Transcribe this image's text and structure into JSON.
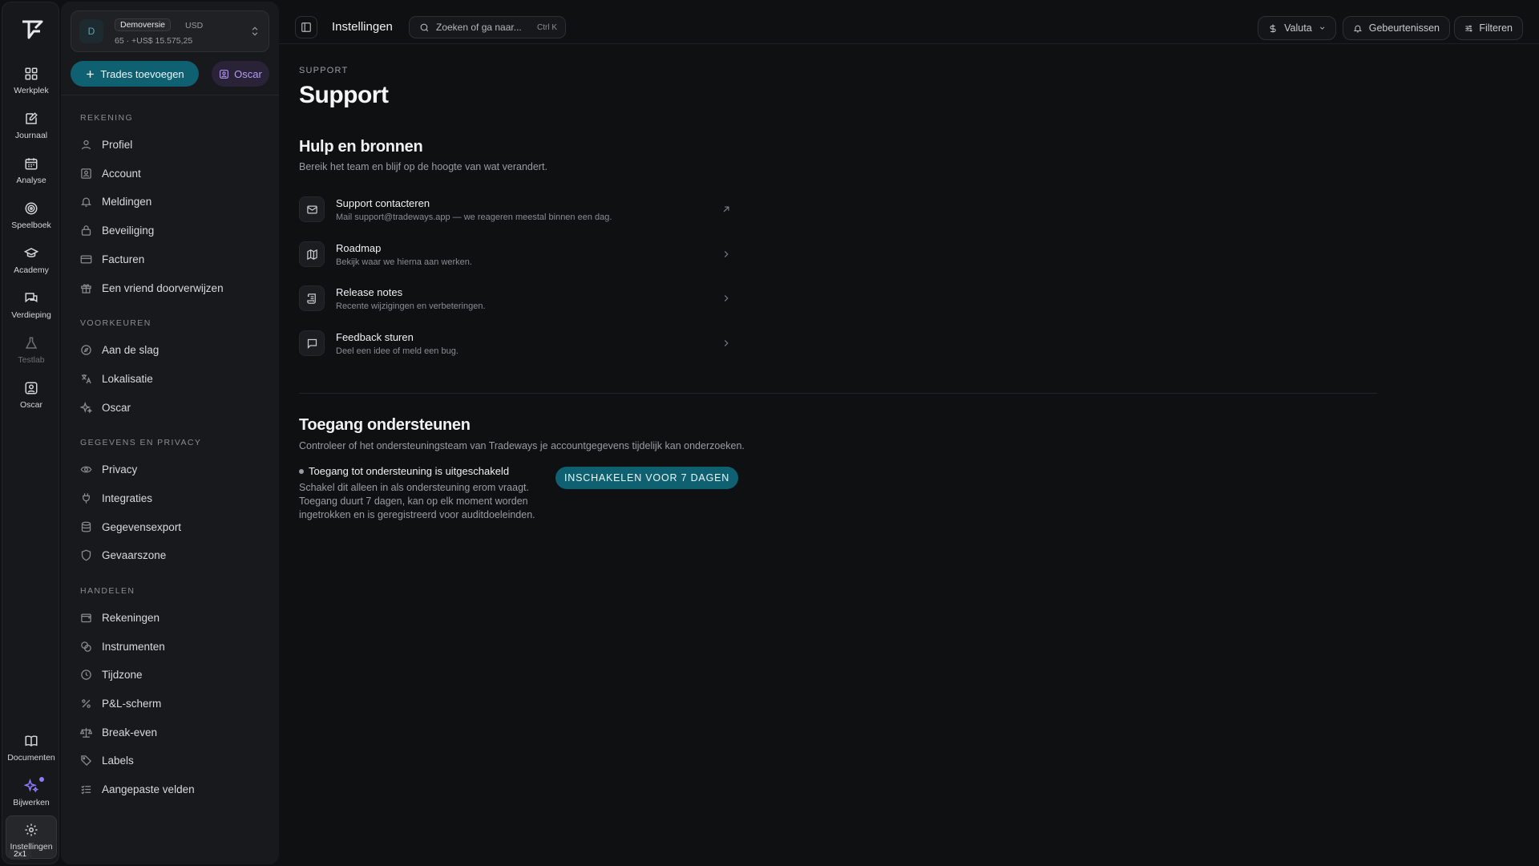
{
  "rail": {
    "items": [
      {
        "label": "Werkplek",
        "icon": "grid-icon"
      },
      {
        "label": "Journaal",
        "icon": "edit-note-icon"
      },
      {
        "label": "Analyse",
        "icon": "calendar-icon"
      },
      {
        "label": "Speelboek",
        "icon": "target-icon"
      },
      {
        "label": "Academy",
        "icon": "graduation-cap-icon"
      },
      {
        "label": "Verdieping",
        "icon": "chat-icon"
      },
      {
        "label": "Testlab",
        "icon": "flask-icon"
      },
      {
        "label": "Oscar",
        "icon": "user-square-icon"
      }
    ],
    "bottom": [
      {
        "label": "Documenten",
        "icon": "book-icon"
      },
      {
        "label": "Bijwerken",
        "icon": "sparkles-icon"
      },
      {
        "label": "Instellingen",
        "icon": "gear-icon"
      }
    ],
    "badge": "2x1"
  },
  "account": {
    "avatar_letter": "D",
    "name": "Demoversie",
    "currency": "USD",
    "balance": "65 · +US$ 15.575,25"
  },
  "actions": {
    "add_trades": "Trades toevoegen",
    "oscar": "Oscar"
  },
  "sidebar": {
    "sections": [
      {
        "title": "REKENING",
        "items": [
          "Profiel",
          "Account",
          "Meldingen",
          "Beveiliging",
          "Facturen",
          "Een vriend doorverwijzen"
        ]
      },
      {
        "title": "VOORKEUREN",
        "items": [
          "Aan de slag",
          "Lokalisatie",
          "Oscar"
        ]
      },
      {
        "title": "GEGEVENS EN PRIVACY",
        "items": [
          "Privacy",
          "Integraties",
          "Gegevensexport",
          "Gevaarszone"
        ]
      },
      {
        "title": "HANDELEN",
        "items": [
          "Rekeningen",
          "Instrumenten",
          "Tijdzone",
          "P&L-scherm",
          "Break-even",
          "Labels",
          "Aangepaste velden"
        ]
      }
    ]
  },
  "topbar": {
    "title": "Instellingen",
    "search_placeholder": "Zoeken of ga naar...",
    "search_shortcut": "Ctrl K",
    "currency": "Valuta",
    "events": "Gebeurtenissen",
    "filters": "Filteren"
  },
  "page": {
    "breadcrumb": "SUPPORT",
    "title": "Support",
    "help": {
      "title": "Hulp en bronnen",
      "subtitle": "Bereik het team en blijf op de hoogte van wat verandert.",
      "rows": [
        {
          "title": "Support contacteren",
          "desc": "Mail support@tradeways.app — we reageren meestal binnen een dag.",
          "icon": "mail-icon"
        },
        {
          "title": "Roadmap",
          "desc": "Bekijk waar we hierna aan werken.",
          "icon": "map-icon"
        },
        {
          "title": "Release notes",
          "desc": "Recente wijzigingen en verbeteringen.",
          "icon": "scroll-icon"
        },
        {
          "title": "Feedback sturen",
          "desc": "Deel een idee of meld een bug.",
          "icon": "message-icon"
        }
      ]
    },
    "access": {
      "title": "Toegang ondersteunen",
      "subtitle": "Controleer of het ondersteuningsteam van Tradeways je accountgegevens tijdelijk kan onderzoeken.",
      "status": "Toegang tot ondersteuning is uitgeschakeld",
      "description": "Schakel dit alleen in als ondersteuning erom vraagt. Toegang duurt 7 dagen, kan op elk moment worden ingetrokken en is geregistreerd voor auditdoeleinden.",
      "button": "INSCHAKELEN VOOR 7 DAGEN"
    }
  }
}
